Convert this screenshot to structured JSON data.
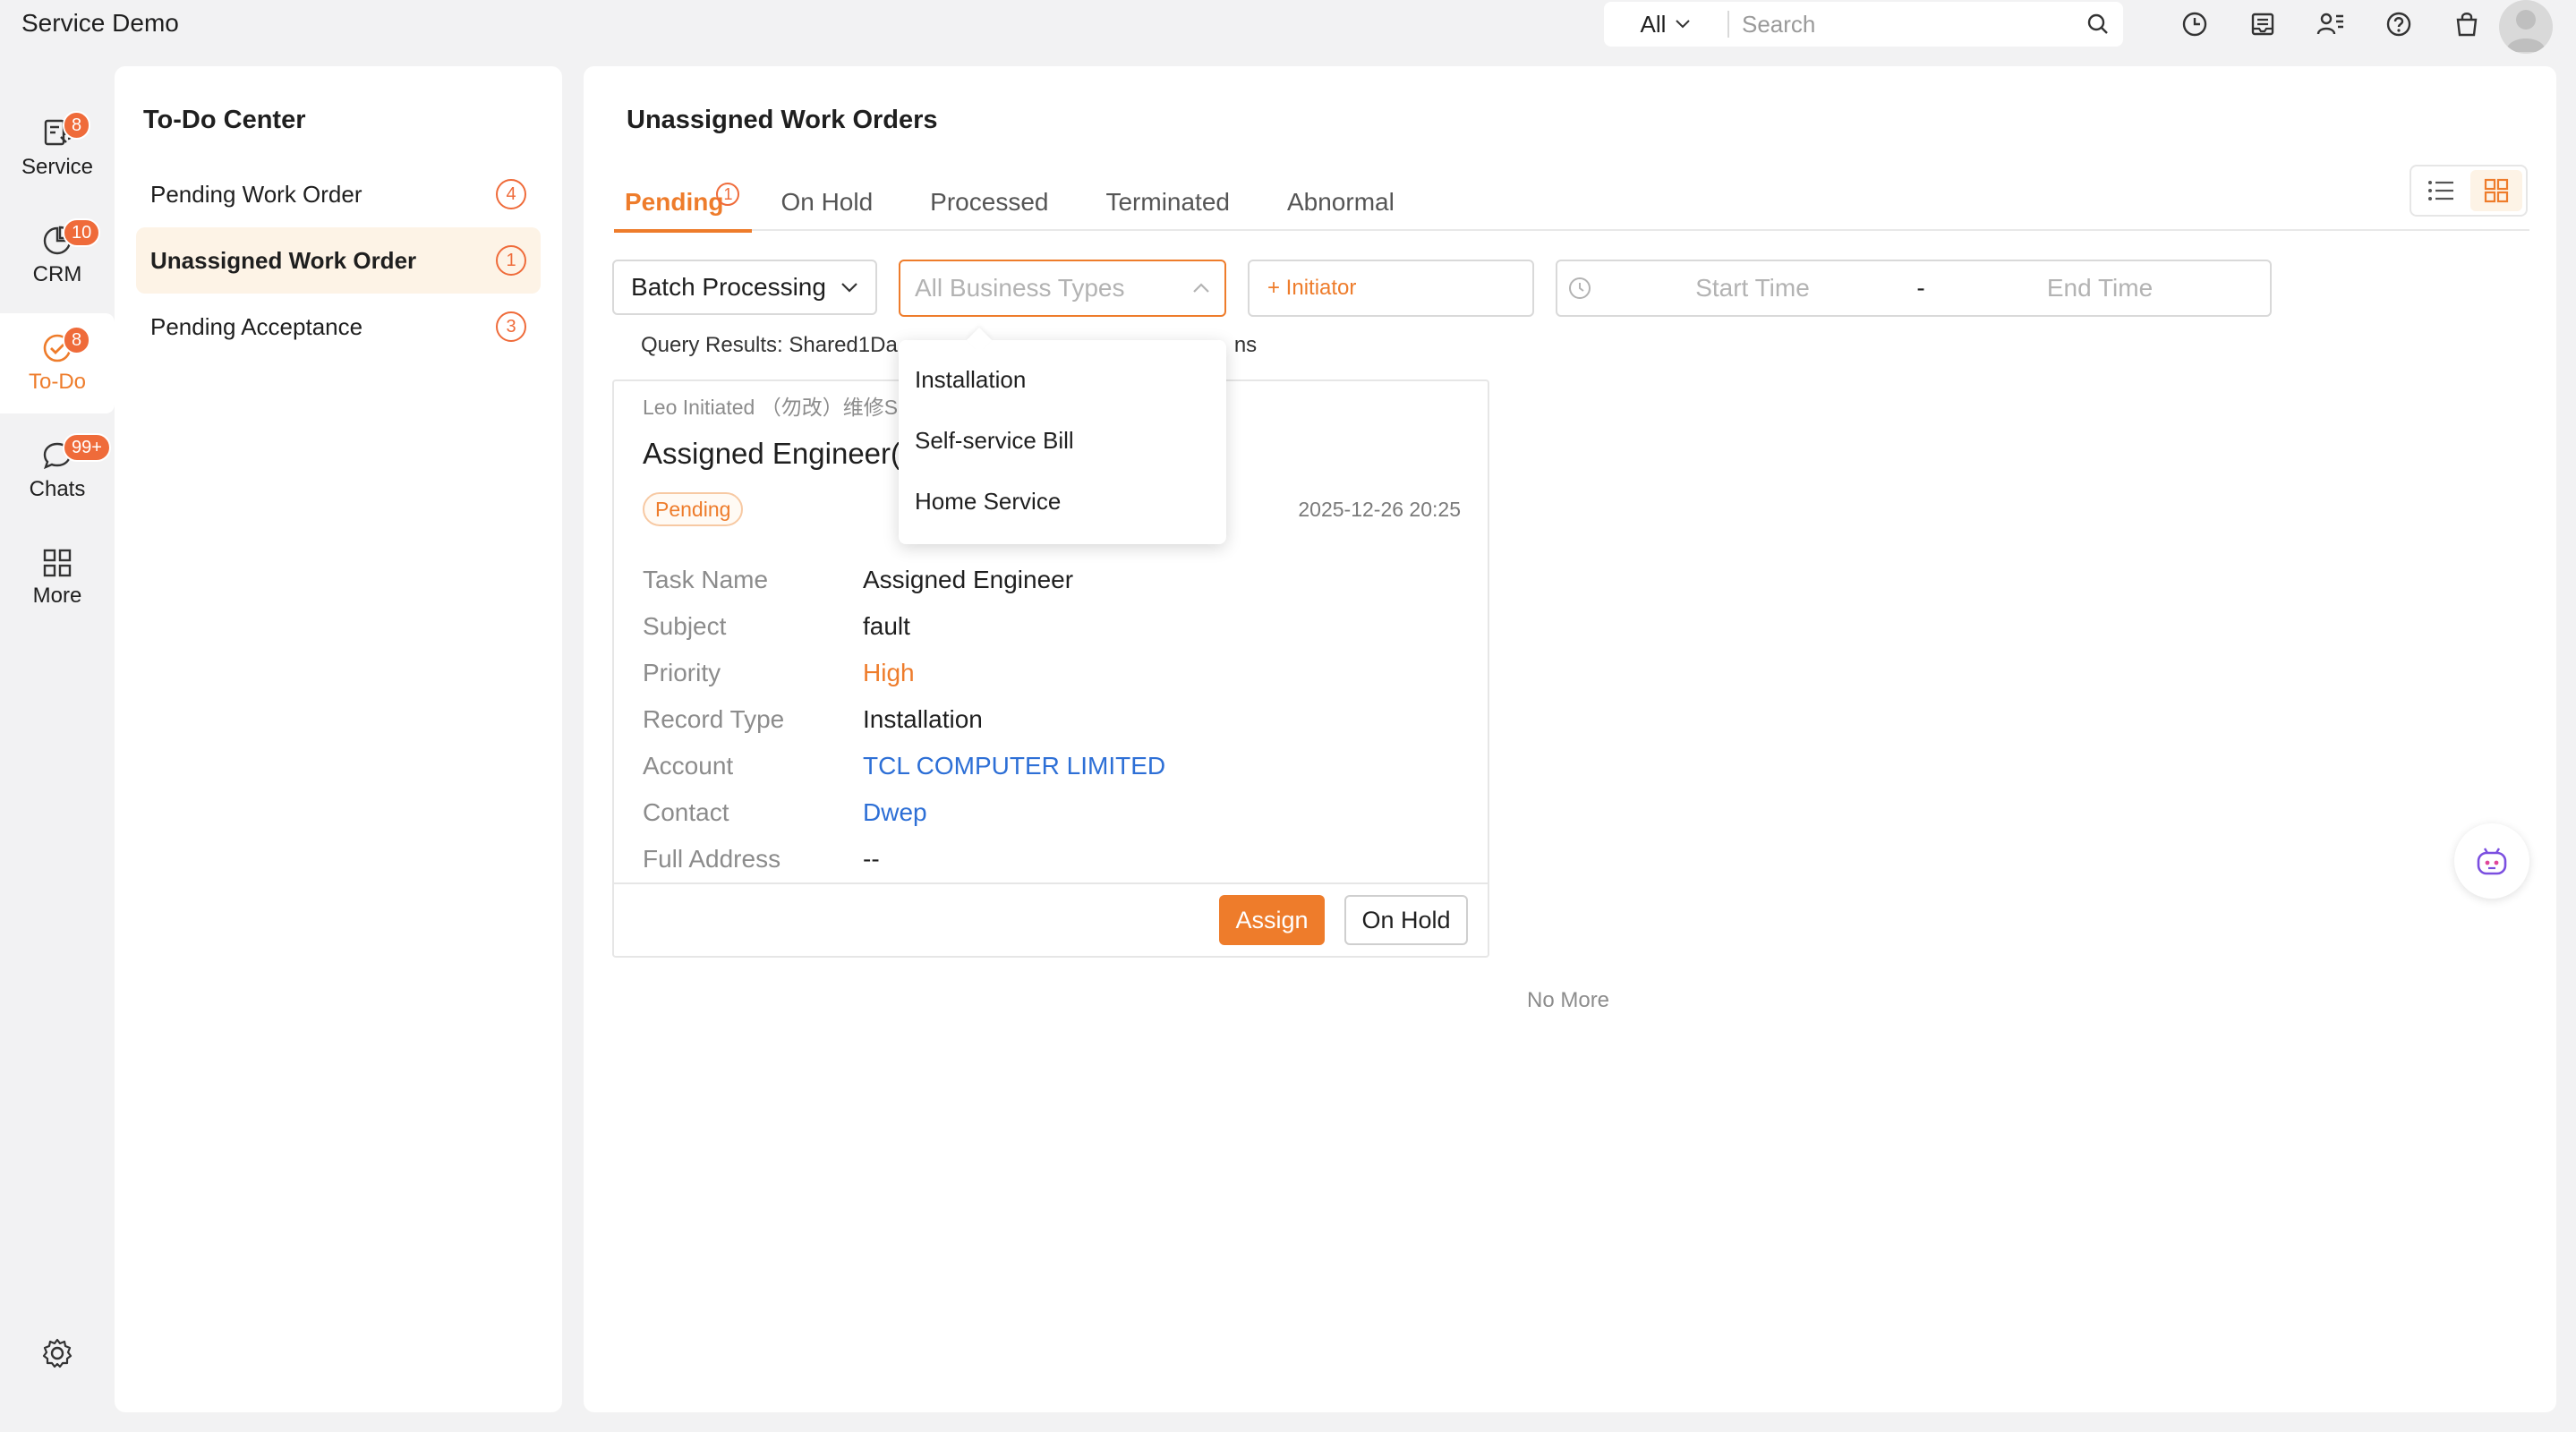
{
  "app": {
    "title": "Service Demo"
  },
  "search": {
    "scope": "All",
    "placeholder": "Search"
  },
  "top_icons": [
    "history-icon",
    "inbox-icon",
    "user-list-icon",
    "help-icon",
    "bag-icon"
  ],
  "left_nav": {
    "items": [
      {
        "label": "Service",
        "badge": "8",
        "icon": "service-icon"
      },
      {
        "label": "CRM",
        "badge": "10",
        "icon": "crm-icon"
      },
      {
        "label": "To-Do",
        "badge": "8",
        "icon": "todo-icon",
        "active": true
      },
      {
        "label": "Chats",
        "badge": "99+",
        "icon": "chat-icon"
      },
      {
        "label": "More",
        "badge": "",
        "icon": "grid-icon"
      }
    ]
  },
  "todo": {
    "title": "To-Do Center",
    "items": [
      {
        "label": "Pending Work Order",
        "count": "4"
      },
      {
        "label": "Unassigned Work Order",
        "count": "1",
        "active": true
      },
      {
        "label": "Pending Acceptance",
        "count": "3"
      }
    ]
  },
  "main": {
    "title": "Unassigned Work Orders",
    "tabs": [
      {
        "label": "Pending",
        "badge": "1",
        "active": true
      },
      {
        "label": "On Hold"
      },
      {
        "label": "Processed"
      },
      {
        "label": "Terminated"
      },
      {
        "label": "Abnormal"
      }
    ],
    "filters": {
      "batch_label": "Batch Processing",
      "business_placeholder": "All Business Types",
      "initiator_label": "+ Initiator",
      "start_placeholder": "Start Time",
      "range_sep": "-",
      "end_placeholder": "End Time"
    },
    "query_results": "Query Results:  Shared1Da",
    "query_results_tail": "ns",
    "dropdown_options": [
      "Installation",
      "Self-service Bill",
      "Home Service"
    ],
    "card": {
      "initiator": "Leo Initiated （勿改）维修S",
      "title": "Assigned Engineer(2",
      "status": "Pending",
      "date": "2025-12-26 20:25",
      "fields": [
        {
          "label": "Task Name",
          "value": "Assigned Engineer"
        },
        {
          "label": "Subject",
          "value": "fault"
        },
        {
          "label": "Priority",
          "value": "High"
        },
        {
          "label": "Record Type",
          "value": "Installation"
        },
        {
          "label": "Account",
          "value": "TCL COMPUTER LIMITED"
        },
        {
          "label": "Contact",
          "value": "Dwep"
        },
        {
          "label": "Full Address",
          "value": "--"
        }
      ],
      "assign_label": "Assign",
      "onhold_label": "On Hold"
    },
    "no_more": "No More"
  },
  "colors": {
    "accent": "#ee7c2b",
    "badge": "#ef6b3a",
    "link": "#2d6fd6"
  }
}
